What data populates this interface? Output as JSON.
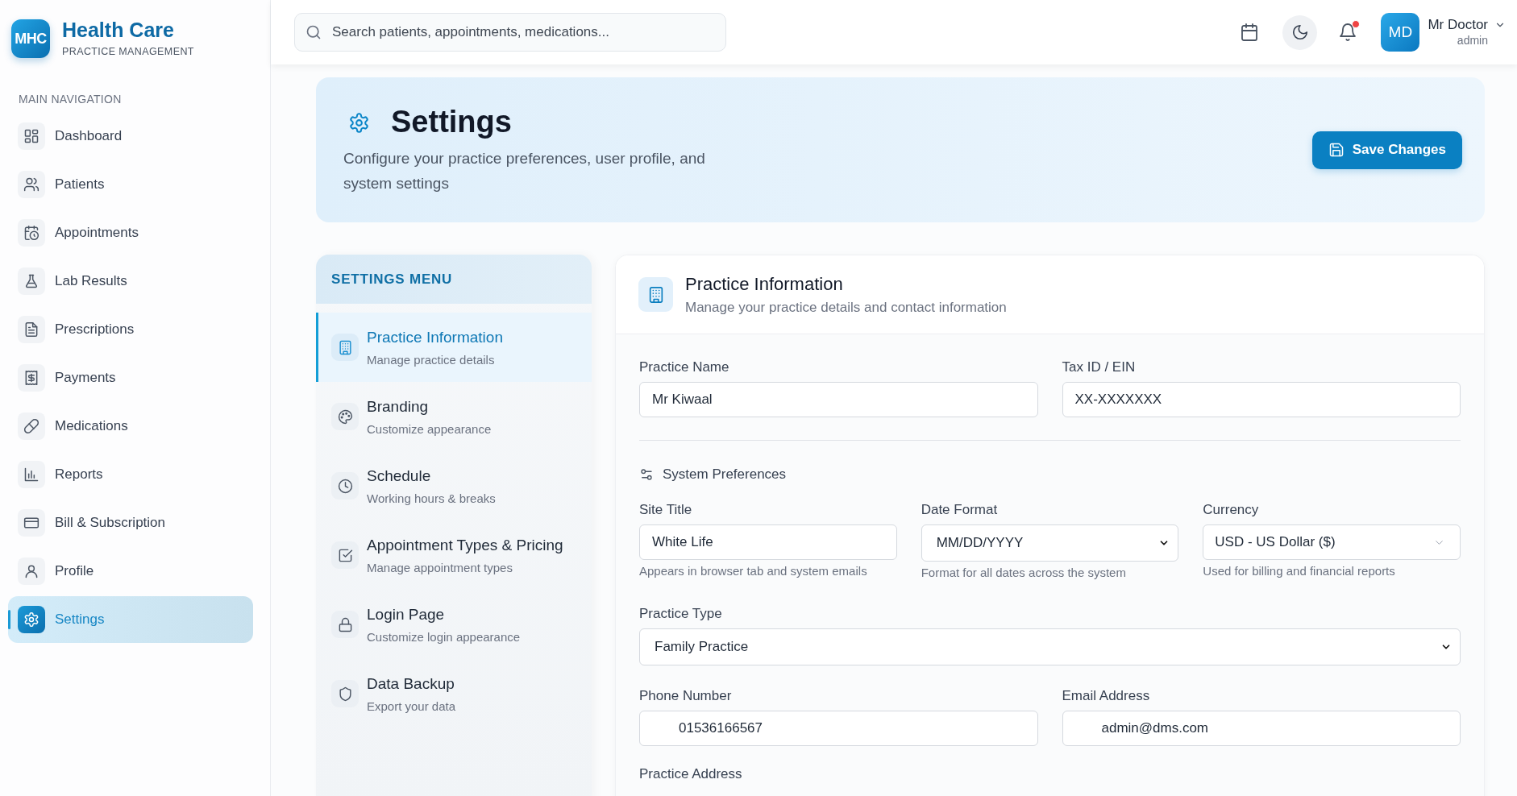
{
  "brand": {
    "logo": "MHC",
    "name": "Health Care",
    "tagline": "PRACTICE MANAGEMENT"
  },
  "sidebar": {
    "heading": "MAIN NAVIGATION",
    "items": [
      {
        "label": "Dashboard",
        "selected": false
      },
      {
        "label": "Patients",
        "selected": false
      },
      {
        "label": "Appointments",
        "selected": false
      },
      {
        "label": "Lab Results",
        "selected": false
      },
      {
        "label": "Prescriptions",
        "selected": false
      },
      {
        "label": "Payments",
        "selected": false
      },
      {
        "label": "Medications",
        "selected": false
      },
      {
        "label": "Reports",
        "selected": false
      },
      {
        "label": "Bill & Subscription",
        "selected": false
      },
      {
        "label": "Profile",
        "selected": false
      },
      {
        "label": "Settings",
        "selected": true
      }
    ]
  },
  "topbar": {
    "search": {
      "placeholder": "Search patients, appointments, medications..."
    },
    "notifications": {
      "unread": true
    },
    "user": {
      "initials": "MD",
      "name": "Mr Doctor",
      "role": "admin"
    }
  },
  "header": {
    "title": "Settings",
    "description": "Configure your practice preferences, user profile, and system settings",
    "button": "Save Changes"
  },
  "settings_menu": {
    "heading": "SETTINGS MENU",
    "items": [
      {
        "title": "Practice Information",
        "subtitle": "Manage practice details",
        "selected": true
      },
      {
        "title": "Branding",
        "subtitle": "Customize appearance",
        "selected": false
      },
      {
        "title": "Schedule",
        "subtitle": "Working hours & breaks",
        "selected": false
      },
      {
        "title": "Appointment Types & Pricing",
        "subtitle": "Manage appointment types",
        "selected": false
      },
      {
        "title": "Login Page",
        "subtitle": "Customize login appearance",
        "selected": false
      },
      {
        "title": "Data Backup",
        "subtitle": "Export your data",
        "selected": false
      }
    ]
  },
  "panel": {
    "title": "Practice Information",
    "subtitle": "Manage your practice details and contact information",
    "rows": [
      {
        "kind": "fields",
        "fields": [
          {
            "kind": "text",
            "label": "Practice Name",
            "value": "Mr Kiwaal"
          },
          {
            "kind": "text",
            "label": "Tax ID / EIN",
            "value": "XX-XXXXXXX"
          }
        ]
      },
      {
        "kind": "divider"
      },
      {
        "kind": "section",
        "title": "System Preferences"
      },
      {
        "kind": "fields",
        "fields": [
          {
            "kind": "text",
            "label": "Site Title",
            "value": "White Life",
            "hint": "Appears in browser tab and system emails"
          },
          {
            "kind": "select",
            "label": "Date Format",
            "value": "MM/DD/YYYY",
            "hint": "Format for all dates across the system"
          },
          {
            "kind": "dropdown",
            "label": "Currency",
            "value": "USD - US Dollar ($)",
            "hint": "Used for billing and financial reports"
          }
        ]
      },
      {
        "kind": "fields",
        "fields": [
          {
            "kind": "select",
            "label": "Practice Type",
            "value": "Family Practice"
          }
        ]
      },
      {
        "kind": "fields",
        "fields": [
          {
            "kind": "phone",
            "label": "Phone Number",
            "value": "01536166567"
          },
          {
            "kind": "email",
            "label": "Email Address",
            "value": "admin@dms.com"
          }
        ]
      },
      {
        "kind": "label",
        "label": "Practice Address"
      }
    ]
  }
}
